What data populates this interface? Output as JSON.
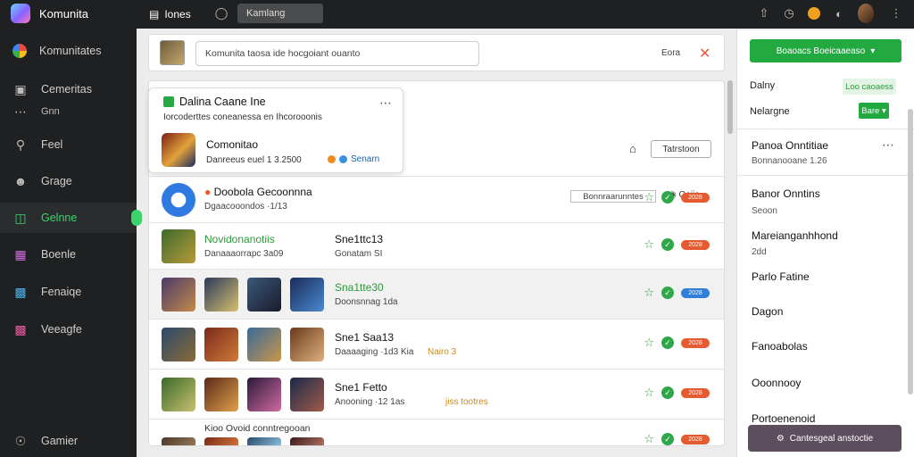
{
  "app": {
    "name": "Komunita"
  },
  "sidebar": {
    "items": [
      {
        "label": "Komunitates",
        "icon": "colorful-circle-icon"
      },
      {
        "label": "Cemeritas",
        "icon": "monitor-icon"
      },
      {
        "label": "Gnn",
        "icon": "dots-icon"
      },
      {
        "label": "Feel",
        "icon": "search-icon"
      },
      {
        "label": "Grage",
        "icon": "user-icon"
      },
      {
        "label": "Gelnne",
        "icon": "folder-icon"
      },
      {
        "label": "Boenle",
        "icon": "grid-icon"
      },
      {
        "label": "Fenaiqe",
        "icon": "image-icon"
      },
      {
        "label": "Veeagfe",
        "icon": "photo-icon"
      },
      {
        "label": "Gamier",
        "icon": "gamepad-icon"
      }
    ]
  },
  "topbar": {
    "tab_label": "Iones",
    "search_text": "Kamlang"
  },
  "search": {
    "text": "Komunita taosa ide hocgoiant ouanto",
    "side_label": "Eora"
  },
  "popover": {
    "title": "Dalina Caane Ine",
    "subtitle": "Iorcoderttes coneanessa en Ihcorooonis",
    "game_name": "Comonitao",
    "game_meta": "Danreeus euel 1 3.2500",
    "pill_label": "Senarn"
  },
  "tools": {
    "button_label": "Tatrstoon",
    "filter_label": "Bonnraarunntes",
    "filter2_label": "Ooiie"
  },
  "rows": [
    {
      "title": "Doobola Gecoonnna",
      "meta": "Dgaacooondos ·1/13",
      "tag": "2028"
    },
    {
      "title": "Novidonanotiis",
      "extra": "Sne1ttc13",
      "meta": "Danaaaorrapc 3a09",
      "meta2": "Gonatam SI",
      "tag": "2028"
    },
    {
      "title": "Sna1tte30",
      "meta": "Doonsnnag 1da",
      "tag": "2028",
      "tag_blue": true
    },
    {
      "title": "Sne1 Saa13",
      "meta": "Daaaaging ·1d3 Kia",
      "meta2": "Nairo 3",
      "tag": "2028"
    },
    {
      "title": "Sne1 Fetto",
      "meta": "Anooning ·12 1as",
      "meta2": "jiss tootres",
      "tag": "2028"
    },
    {
      "title": "Kioo Ovoid conntregooan",
      "meta": "",
      "tag": "2028"
    }
  ],
  "right": {
    "cta_label": "Boaoacs Boeicaaeaso",
    "line1": "Dalny",
    "line1_pill": "Loo caoaess",
    "line2": "Nelargne",
    "line2_btn": "Bare",
    "section_title": "Panoa Onntitiae",
    "section_sub": "Bonnanooane 1.26",
    "items": [
      {
        "title": "Banor Onntins",
        "sub": "Seoon"
      },
      {
        "title": "Mareianganhhond",
        "sub": "2dd"
      },
      {
        "title": "Parlo Fatine",
        "sub": ""
      },
      {
        "title": "Dagon",
        "sub": ""
      },
      {
        "title": "Fanoabolas",
        "sub": ""
      },
      {
        "title": "Ooonnooy",
        "sub": ""
      },
      {
        "title": "Portoenenoid",
        "sub": ""
      }
    ],
    "bottom_label": "Cantesgeal anstoctie"
  }
}
